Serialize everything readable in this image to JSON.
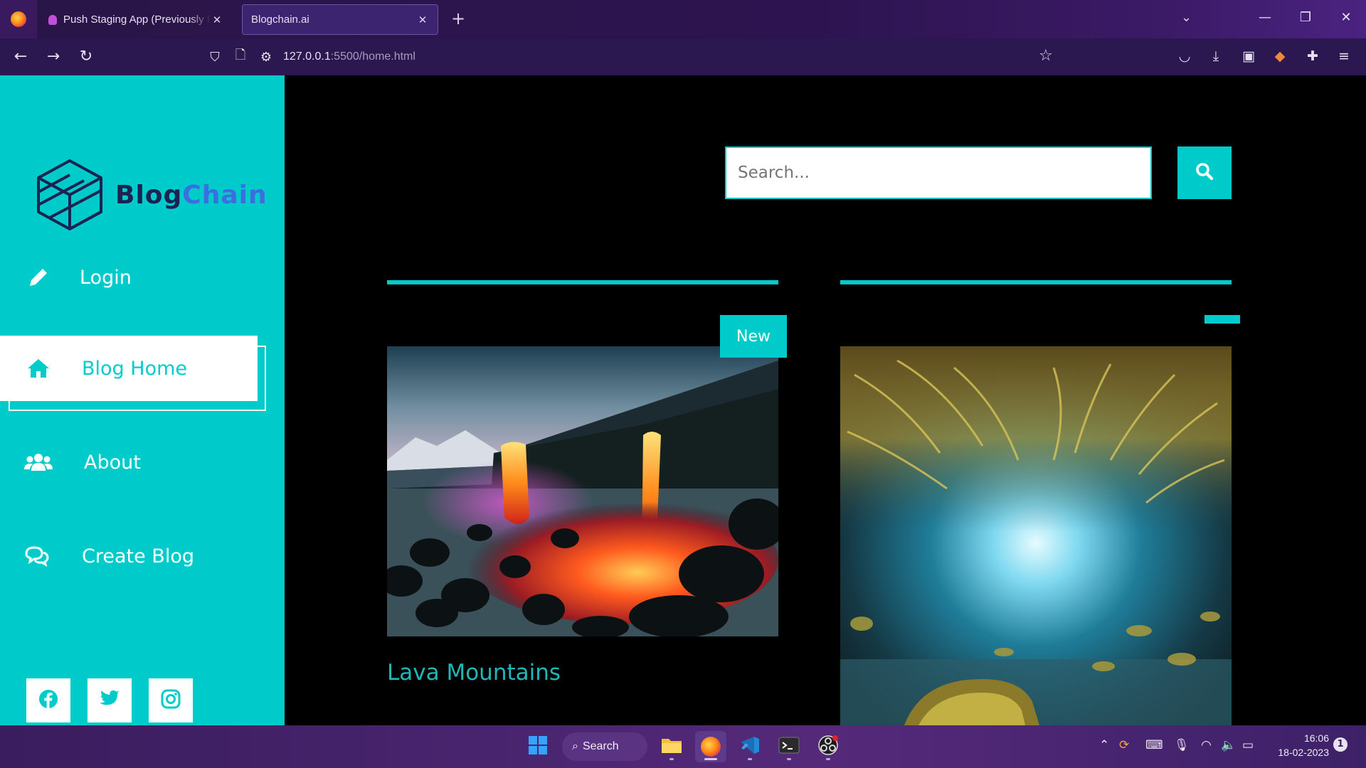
{
  "browser": {
    "tabs": [
      {
        "title": "Push Staging App (Previously EPNS)",
        "active": false
      },
      {
        "title": "Blogchain.ai",
        "active": true
      }
    ],
    "url_host": "127.0.0.1",
    "url_rest": ":5500/home.html"
  },
  "brand": {
    "part1": "Blog",
    "part2": "Chain"
  },
  "sidebar": {
    "items": [
      {
        "label": "Login",
        "icon": "pencil-icon"
      },
      {
        "label": "Blog Home",
        "icon": "home-icon",
        "active": true
      },
      {
        "label": "About",
        "icon": "users-icon"
      },
      {
        "label": "Create Blog",
        "icon": "comments-icon"
      }
    ],
    "social": [
      "facebook-icon",
      "twitter-icon",
      "instagram-icon"
    ]
  },
  "search": {
    "placeholder": "Search..."
  },
  "posts": [
    {
      "title": "Lava Mountains",
      "badge": "New"
    },
    {
      "title": "",
      "badge": ""
    }
  ],
  "taskbar": {
    "search_label": "Search",
    "time": "16:06",
    "date": "18-02-2023"
  },
  "colors": {
    "accent": "#00cbcb",
    "brand_dark": "#1b2353",
    "brand_blue": "#3b6ee0"
  }
}
